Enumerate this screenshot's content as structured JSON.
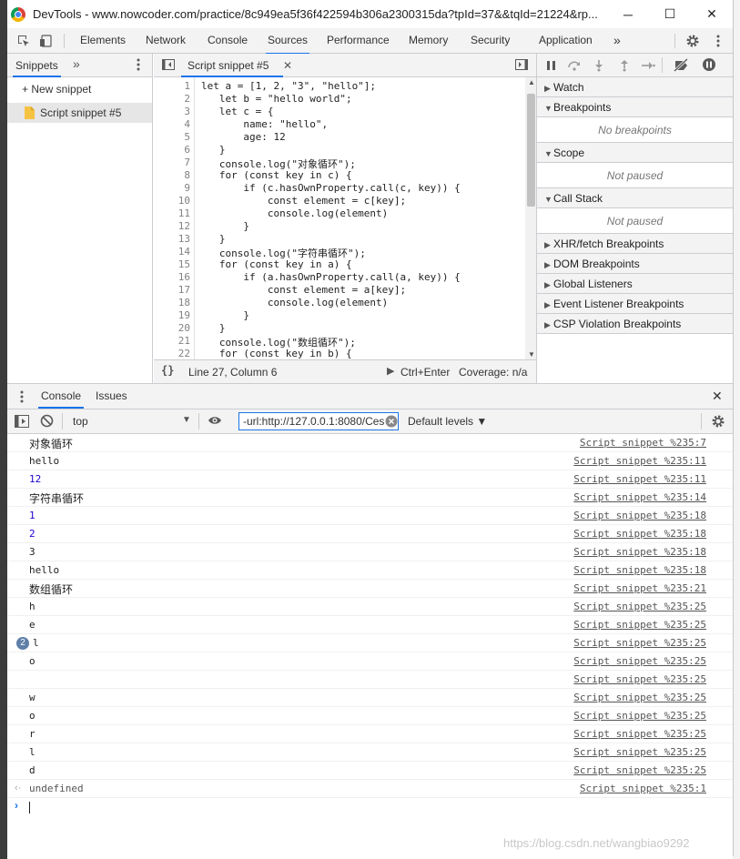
{
  "window": {
    "title": "DevTools - www.nowcoder.com/practice/8c949ea5f36f422594b306a2300315da?tpId=37&&tqId=21224&rp...",
    "minimize": "─",
    "maximize": "☐",
    "close": "✕"
  },
  "main_tabs": [
    "Elements",
    "Network",
    "Console",
    "Sources",
    "Performance",
    "Memory",
    "Security",
    "Application"
  ],
  "more_tabs": "»",
  "nav": {
    "tab": "Snippets",
    "more": "»",
    "new_snippet": "+ New snippet",
    "item": "Script snippet #5"
  },
  "editor": {
    "tab": "Script snippet #5",
    "close": "✕",
    "lines": [
      {
        "n": "1",
        "t": "let a = [1, 2, \"3\", \"hello\"];"
      },
      {
        "n": "2",
        "t": "   let b = \"hello world\";"
      },
      {
        "n": "3",
        "t": "   let c = {"
      },
      {
        "n": "4",
        "t": "       name: \"hello\","
      },
      {
        "n": "5",
        "t": "       age: 12"
      },
      {
        "n": "6",
        "t": "   }"
      },
      {
        "n": "7",
        "t": "   console.log(\"对象循环\");"
      },
      {
        "n": "8",
        "t": "   for (const key in c) {"
      },
      {
        "n": "9",
        "t": "       if (c.hasOwnProperty.call(c, key)) {"
      },
      {
        "n": "10",
        "t": "           const element = c[key];"
      },
      {
        "n": "11",
        "t": "           console.log(element)"
      },
      {
        "n": "12",
        "t": "       }"
      },
      {
        "n": "13",
        "t": "   }"
      },
      {
        "n": "14",
        "t": "   console.log(\"字符串循环\");"
      },
      {
        "n": "15",
        "t": "   for (const key in a) {"
      },
      {
        "n": "16",
        "t": "       if (a.hasOwnProperty.call(a, key)) {"
      },
      {
        "n": "17",
        "t": "           const element = a[key];"
      },
      {
        "n": "18",
        "t": "           console.log(element)"
      },
      {
        "n": "19",
        "t": "       }"
      },
      {
        "n": "20",
        "t": "   }"
      },
      {
        "n": "21",
        "t": "   console.log(\"数组循环\");"
      },
      {
        "n": "22",
        "t": "   for (const key in b) {"
      }
    ],
    "status_position": "Line 27, Column 6",
    "run_hint": "Ctrl+Enter",
    "coverage": "Coverage: n/a"
  },
  "debugger": {
    "panes": [
      {
        "label": "Watch"
      },
      {
        "label": "Breakpoints",
        "body": "No breakpoints"
      },
      {
        "label": "Scope",
        "body": "Not paused"
      },
      {
        "label": "Call Stack",
        "body": "Not paused"
      },
      {
        "label": "XHR/fetch Breakpoints"
      },
      {
        "label": "DOM Breakpoints"
      },
      {
        "label": "Global Listeners"
      },
      {
        "label": "Event Listener Breakpoints"
      },
      {
        "label": "CSP Violation Breakpoints"
      }
    ]
  },
  "drawer": {
    "tabs": [
      "Console",
      "Issues"
    ],
    "close": "✕",
    "context": "top",
    "filter": "-url:http://127.0.0.1:8080/Ces",
    "levels": "Default levels ▼"
  },
  "console_messages": [
    {
      "text": "对象循环",
      "src": "Script snippet %235:7",
      "color": "#222",
      "cjk": true
    },
    {
      "text": "hello",
      "src": "Script snippet %235:11",
      "color": "#222"
    },
    {
      "text": "12",
      "src": "Script snippet %235:11",
      "color": "#1c00cf"
    },
    {
      "text": "字符串循环",
      "src": "Script snippet %235:14",
      "color": "#222",
      "cjk": true
    },
    {
      "text": "1",
      "src": "Script snippet %235:18",
      "color": "#1c00cf"
    },
    {
      "text": "2",
      "src": "Script snippet %235:18",
      "color": "#1c00cf"
    },
    {
      "text": "3",
      "src": "Script snippet %235:18",
      "color": "#222"
    },
    {
      "text": "hello",
      "src": "Script snippet %235:18",
      "color": "#222"
    },
    {
      "text": "数组循环",
      "src": "Script snippet %235:21",
      "color": "#222",
      "cjk": true
    },
    {
      "text": "h",
      "src": "Script snippet %235:25",
      "color": "#222"
    },
    {
      "text": "e",
      "src": "Script snippet %235:25",
      "color": "#222"
    },
    {
      "text": "l",
      "src": "Script snippet %235:25",
      "color": "#222",
      "count": "2"
    },
    {
      "text": "o",
      "src": "Script snippet %235:25",
      "color": "#222"
    },
    {
      "text": "",
      "src": "Script snippet %235:25",
      "color": "#222"
    },
    {
      "text": "w",
      "src": "Script snippet %235:25",
      "color": "#222"
    },
    {
      "text": "o",
      "src": "Script snippet %235:25",
      "color": "#222"
    },
    {
      "text": "r",
      "src": "Script snippet %235:25",
      "color": "#222"
    },
    {
      "text": "l",
      "src": "Script snippet %235:25",
      "color": "#222"
    },
    {
      "text": "d",
      "src": "Script snippet %235:25",
      "color": "#222"
    },
    {
      "text": "undefined",
      "src": "Script snippet %235:1",
      "color": "#555",
      "result": true
    }
  ],
  "watermark": "https://blog.csdn.net/wangbiao9292",
  "colors": {
    "accent": "#1a73e8",
    "number": "#1c00cf",
    "keyword": "#aa0d91",
    "string": "#c41a16"
  }
}
